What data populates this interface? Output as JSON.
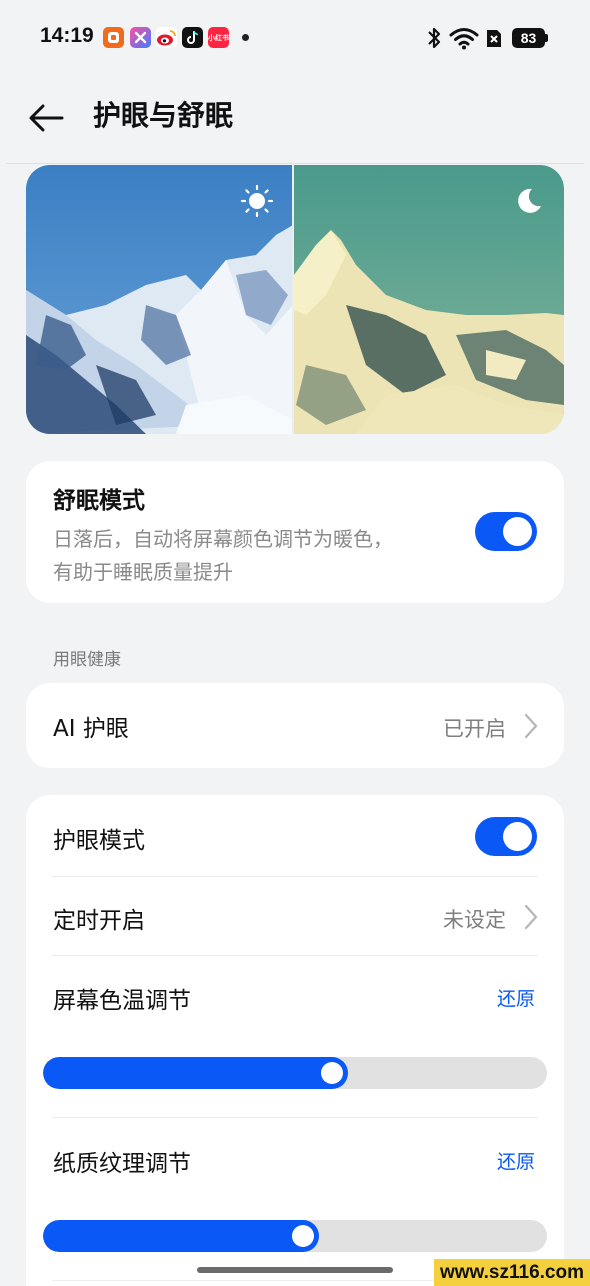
{
  "status_bar": {
    "time": "14:19",
    "battery": "83",
    "icons": [
      "app-orange-icon",
      "app-colorful-icon",
      "weibo-icon",
      "tiktok-icon",
      "xiaohongshu-icon",
      "bluetooth-icon",
      "wifi-icon",
      "no-sim-icon"
    ],
    "xhs_label": "小红书"
  },
  "header": {
    "title": "护眼与舒眠",
    "back_icon": "arrow-left-icon"
  },
  "preview": {
    "left_icon": "sun-icon",
    "right_icon": "moon-icon"
  },
  "sleep_mode": {
    "title": "舒眠模式",
    "desc_line1": "日落后，自动将屏幕颜色调节为暖色，",
    "desc_line2": "有助于睡眠质量提升",
    "enabled": true
  },
  "section": {
    "label": "用眼健康"
  },
  "ai_eye": {
    "title": "AI 护眼",
    "value": "已开启"
  },
  "eye_comfort": {
    "mode_title": "护眼模式",
    "mode_enabled": true,
    "schedule_title": "定时开启",
    "schedule_value": "未设定",
    "color_temp_title": "屏幕色温调节",
    "color_temp_restore": "还原",
    "color_temp_level": 0.605,
    "paper_title": "纸质纹理调节",
    "paper_restore": "还原",
    "paper_level": 0.548
  },
  "colors": {
    "accent": "#0a59f7",
    "background": "#f1f3f5",
    "card": "#ffffff",
    "secondary_text": "#8a8a8a"
  },
  "watermark": "www.sz116.com"
}
